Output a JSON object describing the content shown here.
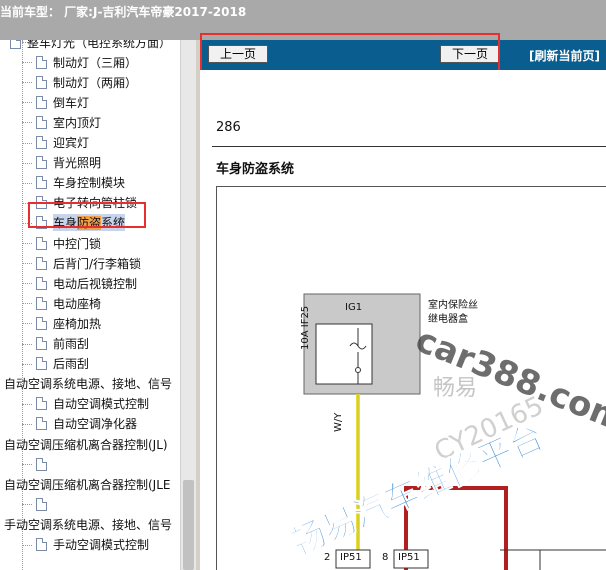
{
  "header": {
    "title": "当前车型： 厂家:J-吉利汽车帝豪2017-2018"
  },
  "sidebar": {
    "items": [
      {
        "label": "整车灯光（电控系统方面）",
        "indent": 1
      },
      {
        "label": "制动灯（三厢）",
        "indent": 2
      },
      {
        "label": "制动灯（两厢）",
        "indent": 2
      },
      {
        "label": "倒车灯",
        "indent": 2
      },
      {
        "label": "室内顶灯",
        "indent": 2
      },
      {
        "label": "迎宾灯",
        "indent": 2
      },
      {
        "label": "背光照明",
        "indent": 2
      },
      {
        "label": "车身控制模块",
        "indent": 2
      },
      {
        "label": "电子转向管柱锁",
        "indent": 2
      },
      {
        "label_pre": "车身",
        "label_hl": "防盗",
        "label_post": "系统",
        "indent": 2,
        "selected": true
      },
      {
        "label": "中控门锁",
        "indent": 2
      },
      {
        "label": "后背门/行李箱锁",
        "indent": 2
      },
      {
        "label": "电动后视镜控制",
        "indent": 2
      },
      {
        "label": "电动座椅",
        "indent": 2
      },
      {
        "label": "座椅加热",
        "indent": 2
      },
      {
        "label": "前雨刮",
        "indent": 2
      },
      {
        "label": "后雨刮",
        "indent": 2
      },
      {
        "label": "自动空调系统电源、接地、信号",
        "indent": 0
      },
      {
        "label": "自动空调模式控制",
        "indent": 2
      },
      {
        "label": "自动空调净化器",
        "indent": 2
      },
      {
        "label": "自动空调压缩机离合器控制(JL)",
        "indent": 0
      },
      {
        "label": "",
        "indent": 2
      },
      {
        "label": "自动空调压缩机离合器控制(JLE",
        "indent": 0
      },
      {
        "label": "",
        "indent": 2
      },
      {
        "label": "手动空调系统电源、接地、信号",
        "indent": 0
      },
      {
        "label": "手动空调模式控制",
        "indent": 2
      }
    ]
  },
  "nav": {
    "prev": "上一页",
    "next": "下一页",
    "refresh": "[刷新当前页]"
  },
  "document": {
    "page_number": "286",
    "section_title": "车身防盗系统",
    "diagram": {
      "fuse_box_label_line1": "室内保险丝",
      "fuse_box_label_line2": "继电器盒",
      "fuse_header": "IG1",
      "fuse_label": "10A IF25",
      "wire_color": "W/Y",
      "pin_left_num": "2",
      "pin_left_conn": "IP51",
      "pin_right_num": "8",
      "pin_right_conn": "IP51"
    }
  },
  "watermarks": {
    "site": "car388.com",
    "brand_short": "畅易",
    "id": "CY20165",
    "main": "畅易汽车维修平台"
  },
  "colors": {
    "nav_bar": "#0a5d8f",
    "topbar": "#a9a9a9",
    "selection": "#c7d4ec",
    "highlight": "#f0a14a",
    "annotation_red": "#e53030"
  }
}
